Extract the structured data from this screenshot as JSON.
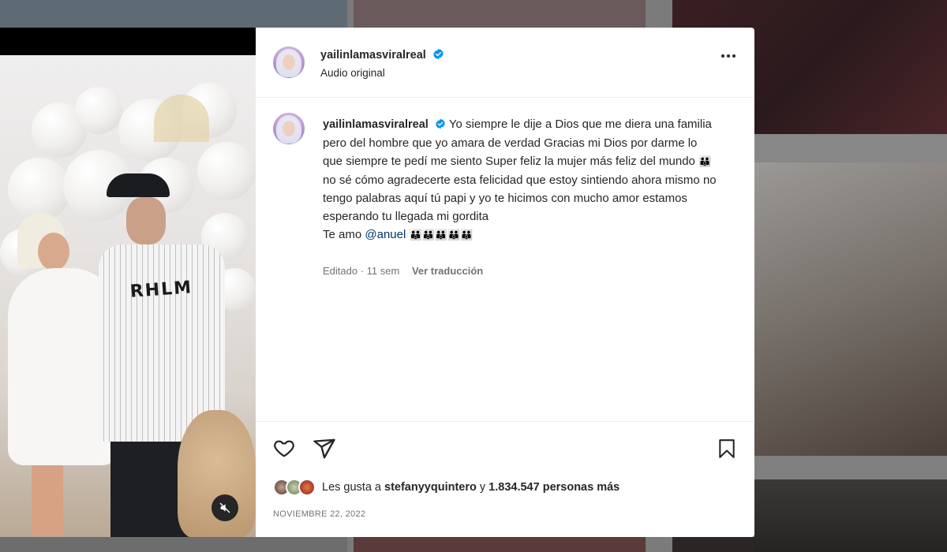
{
  "post": {
    "username": "yailinlamasviralreal",
    "subtitle": "Audio original",
    "caption_text": "Yo siempre le dije a Dios que me diera una familia pero del hombre que yo amara de verdad Gracias mi Dios por darme lo que siempre te pedí me siento Super feliz la mujer más feliz del mundo",
    "caption_text_2": "no sé cómo agradecerte esta felicidad que estoy sintiendo ahora mismo no tengo palabras aquí tú papi y yo te hicimos con mucho amor estamos esperando tu llegada mi gordita",
    "caption_prefix_line": "Te amo",
    "mention": "@anuel",
    "emoji_family": "👪",
    "emoji_family_row": "👪👪👪👪👪",
    "edited_label": "Editado · 11 sem",
    "translate_label": "Ver traducción",
    "likes_prefix": "Les gusta a",
    "likes_user": "stefanyyquintero",
    "likes_mid": "y",
    "likes_count": "1.834.547 personas más",
    "date": "NOVIEMBRE 22, 2022"
  },
  "colors": {
    "verified_blue": "#0095f6",
    "text": "#262626",
    "muted": "#737373",
    "mention": "#00376b"
  },
  "icons": [
    "verified-icon",
    "more-options-icon",
    "heart-icon",
    "share-icon",
    "bookmark-icon",
    "mute-icon"
  ]
}
